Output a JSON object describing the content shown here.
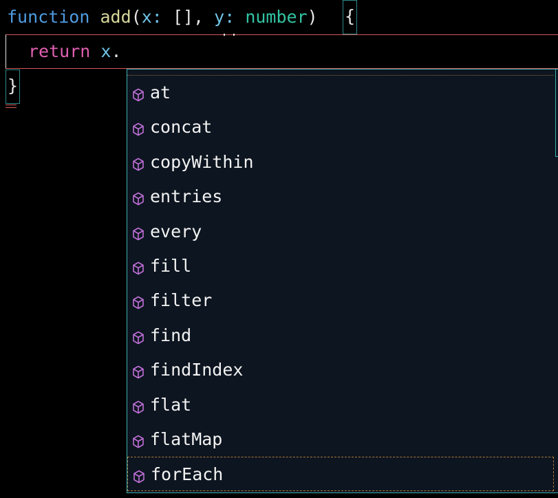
{
  "editor": {
    "line1": {
      "keyword": "function",
      "name": "add",
      "open_paren": "(",
      "param1": "x",
      "colon1": ":",
      "param1_type": "[]",
      "comma": ",",
      "param2": "y",
      "colon2": ":",
      "param2_type": "number",
      "close_paren": ")",
      "open_brace": "{"
    },
    "line2": {
      "keyword": "return",
      "expr": "x",
      "dot": "."
    },
    "line3": {
      "close_brace": "}"
    }
  },
  "suggestions": {
    "icon": "method-cube-icon",
    "icon_color": "#c070d8",
    "items": [
      {
        "label": "at"
      },
      {
        "label": "concat"
      },
      {
        "label": "copyWithin"
      },
      {
        "label": "entries"
      },
      {
        "label": "every"
      },
      {
        "label": "fill"
      },
      {
        "label": "filter"
      },
      {
        "label": "find"
      },
      {
        "label": "findIndex"
      },
      {
        "label": "flat"
      },
      {
        "label": "flatMap"
      },
      {
        "label": "forEach"
      }
    ],
    "selected_label": "forEach"
  }
}
